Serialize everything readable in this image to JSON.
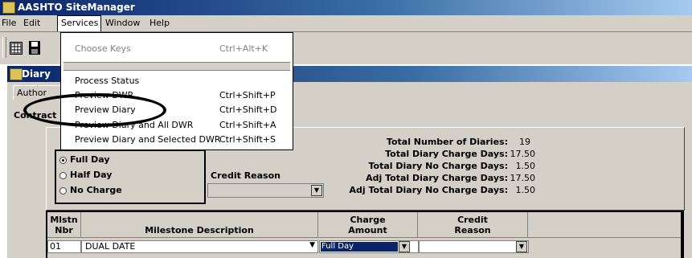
{
  "app": {
    "title": "AASHTO SiteManager"
  },
  "menubar": {
    "items": [
      "File",
      "Edit",
      "Services",
      "Window",
      "Help"
    ]
  },
  "services_menu": {
    "items": [
      {
        "label": "Choose Keys",
        "shortcut": "Ctrl+Alt+K",
        "enabled": false
      },
      {
        "label": "Process Status",
        "shortcut": "",
        "enabled": true
      },
      {
        "label": "Preview DWR",
        "shortcut": "Ctrl+Shift+P",
        "enabled": true
      },
      {
        "label": "Preview Diary",
        "shortcut": "Ctrl+Shift+D",
        "enabled": true
      },
      {
        "label": "Preview Diary and All DWR",
        "shortcut": "Ctrl+Shift+A",
        "enabled": true
      },
      {
        "label": "Preview Diary and Selected DWR",
        "shortcut": "Ctrl+Shift+S",
        "enabled": true
      }
    ]
  },
  "window": {
    "title": "Diary"
  },
  "tabs": [
    "Author",
    "Contract"
  ],
  "charge_type": {
    "options": [
      "Full Day",
      "Half Day",
      "No Charge"
    ],
    "selected": "Full Day"
  },
  "credit_reason": {
    "label": "Credit Reason",
    "value": ""
  },
  "stats": [
    {
      "label": "Total Number of Diaries:",
      "value": "19"
    },
    {
      "label": "Total Diary Charge Days:",
      "value": "17.50"
    },
    {
      "label": "Total Diary No Charge Days:",
      "value": "1.50"
    },
    {
      "label": "Adj Total Diary Charge Days:",
      "value": "17.50"
    },
    {
      "label": "Adj Total Diary No Charge Days:",
      "value": "1.50"
    }
  ],
  "grid": {
    "headers": {
      "mlstn_line1": "Mlstn",
      "mlstn_line2": "Nbr",
      "desc": "Milestone Description",
      "charge_line1": "Charge",
      "charge_line2": "Amount",
      "credit_line1": "Credit",
      "credit_line2": "Reason"
    },
    "rows": [
      {
        "mlstn": "01",
        "desc": "DUAL DATE",
        "charge": "Full Day",
        "credit": ""
      }
    ]
  },
  "colors": {
    "title_gradient_start": "#0a246a",
    "title_gradient_end": "#a6caf0",
    "selection": "#0a246a"
  }
}
